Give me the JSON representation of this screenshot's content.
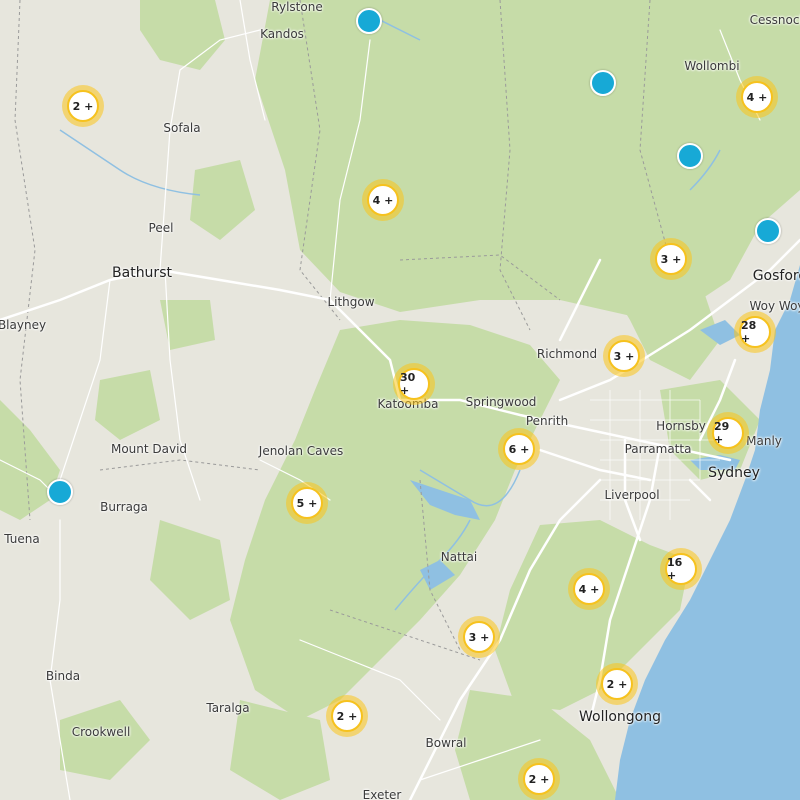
{
  "map": {
    "places": [
      {
        "name": "Rylstone"
      },
      {
        "name": "Kandos"
      },
      {
        "name": "Cessnock"
      },
      {
        "name": "Wollombi"
      },
      {
        "name": "Sofala"
      },
      {
        "name": "Peel"
      },
      {
        "name": "Bathurst"
      },
      {
        "name": "Lithgow"
      },
      {
        "name": "Blayney"
      },
      {
        "name": "Gosford"
      },
      {
        "name": "Woy Woy"
      },
      {
        "name": "Richmond"
      },
      {
        "name": "Springwood"
      },
      {
        "name": "Katoomba"
      },
      {
        "name": "Penrith"
      },
      {
        "name": "Hornsby"
      },
      {
        "name": "Mount David"
      },
      {
        "name": "Jenolan Caves"
      },
      {
        "name": "Parramatta"
      },
      {
        "name": "Manly"
      },
      {
        "name": "Sydney"
      },
      {
        "name": "Liverpool"
      },
      {
        "name": "Burraga"
      },
      {
        "name": "Tuena"
      },
      {
        "name": "Nattai"
      },
      {
        "name": "Binda"
      },
      {
        "name": "Taralga"
      },
      {
        "name": "Crookwell"
      },
      {
        "name": "Wollongong"
      },
      {
        "name": "Bowral"
      },
      {
        "name": "Exeter"
      }
    ],
    "clusters": [
      {
        "label": "2 +"
      },
      {
        "label": "4 +"
      },
      {
        "label": "4 +"
      },
      {
        "label": "3 +"
      },
      {
        "label": "28 +"
      },
      {
        "label": "3 +"
      },
      {
        "label": "30 +"
      },
      {
        "label": "29 +"
      },
      {
        "label": "6 +"
      },
      {
        "label": "5 +"
      },
      {
        "label": "16 +"
      },
      {
        "label": "4 +"
      },
      {
        "label": "3 +"
      },
      {
        "label": "2 +"
      },
      {
        "label": "2 +"
      },
      {
        "label": "2 +"
      }
    ],
    "colors": {
      "land": "#e7e6dd",
      "park": "#c6dca8",
      "water": "#8fc0e2",
      "cluster_ring": "#fcc419",
      "marker": "#17a9d6"
    }
  }
}
